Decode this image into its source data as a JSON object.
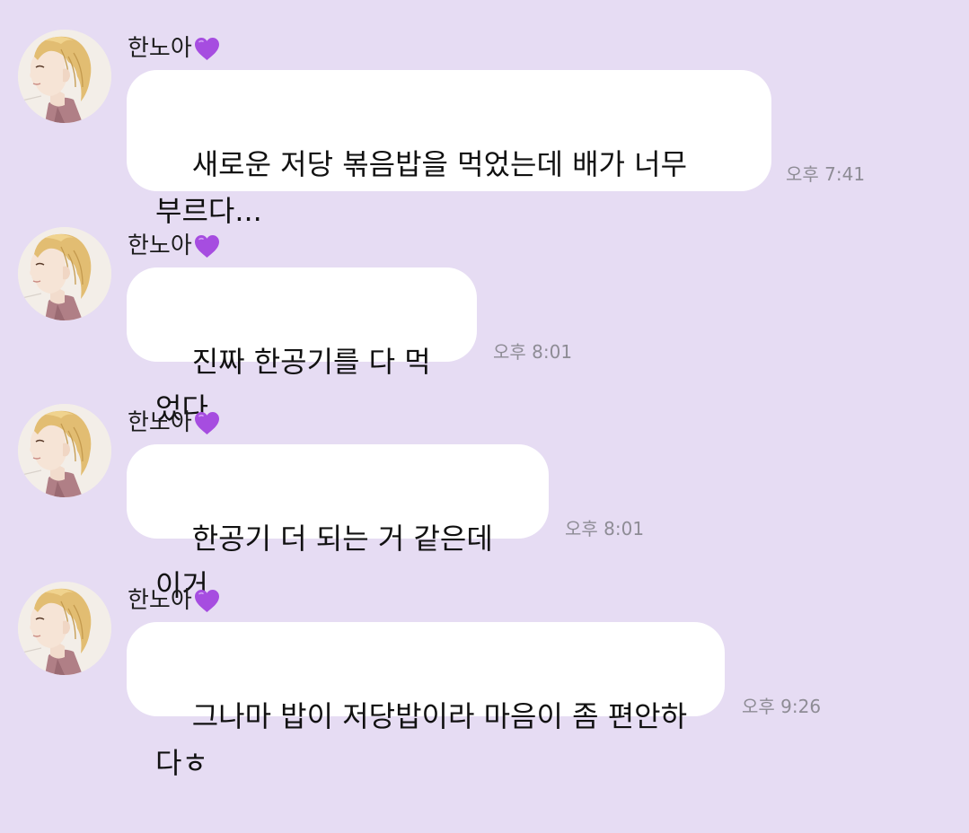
{
  "colors": {
    "background": "#e6dcf3",
    "bubble": "#ffffff",
    "timestamp": "#8e8c95",
    "heart": "#a64de0"
  },
  "messages": [
    {
      "sender": "한노아",
      "heart_icon": "purple-heart-icon",
      "text": "새로운 저당 볶음밥을 먹었는데 배가 너무\n부르다...",
      "time": "오후 7:41"
    },
    {
      "sender": "한노아",
      "heart_icon": "purple-heart-icon",
      "text": "진짜 한공기를 다 먹었다",
      "time": "오후 8:01"
    },
    {
      "sender": "한노아",
      "heart_icon": "purple-heart-icon",
      "text": "한공기 더 되는 거 같은데 이거",
      "time": "오후 8:01"
    },
    {
      "sender": "한노아",
      "heart_icon": "purple-heart-icon",
      "text": "그나마 밥이 저당밥이라 마음이 좀 편안하다ㅎ",
      "time": "오후 9:26"
    }
  ]
}
